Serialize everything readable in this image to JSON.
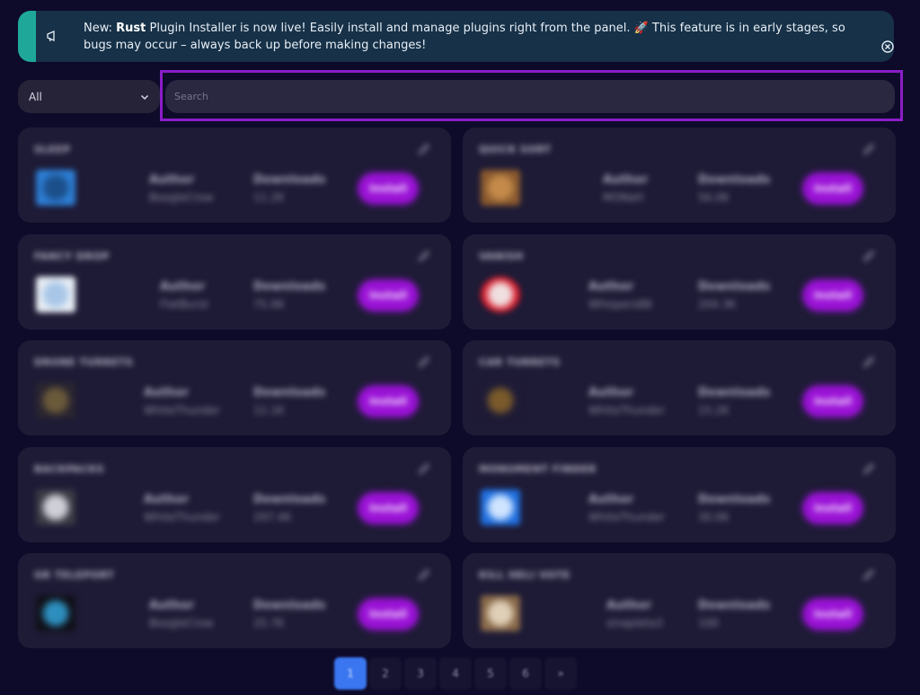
{
  "banner": {
    "prefix": "New: ",
    "bold": "Rust",
    "text": " Plugin Installer is now live! Easily install and manage plugins right from the panel. 🚀 This feature is in early stages, so bugs may occur – always back up before making changes!",
    "accent_color": "#1fa89a"
  },
  "filter": {
    "selected": "All"
  },
  "search": {
    "placeholder": "Search"
  },
  "labels": {
    "author": "Author",
    "downloads": "Downloads",
    "install": "Install"
  },
  "plugins": [
    {
      "title": "SLEEP",
      "author": "BoogleCrow",
      "downloads": "11.2K",
      "icon": "bed-icon"
    },
    {
      "title": "QUICK SORT",
      "author": "MONaH",
      "downloads": "56.0K",
      "icon": "chest-icon"
    },
    {
      "title": "FANCY DROP",
      "author": "FlatBurst",
      "downloads": "75.0K",
      "icon": "diamond-crate-icon"
    },
    {
      "title": "VANISH",
      "author": "Whispers88",
      "downloads": "204.3K",
      "icon": "ghost-icon"
    },
    {
      "title": "DRONE TURRETS",
      "author": "WhiteThunder",
      "downloads": "12.1K",
      "icon": "drone-icon"
    },
    {
      "title": "CAR TURRETS",
      "author": "WhiteThunder",
      "downloads": "15.2K",
      "icon": "turret-icon"
    },
    {
      "title": "BACKPACKS",
      "author": "WhiteThunder",
      "downloads": "297.4K",
      "icon": "backpack-icon"
    },
    {
      "title": "MONUMENT FINDER",
      "author": "WhiteThunder",
      "downloads": "30.0K",
      "icon": "magnifier-icon"
    },
    {
      "title": "GR TELEPORT",
      "author": "BoogleCrow",
      "downloads": "25.7K",
      "icon": "teleport-icon"
    },
    {
      "title": "KILL HELI VOTE",
      "author": "sinapleta3",
      "downloads": "100",
      "icon": "vote-box-icon"
    }
  ],
  "pagination": {
    "pages": [
      "1",
      "2",
      "3",
      "4",
      "5",
      "6",
      "»"
    ],
    "current": "1"
  }
}
